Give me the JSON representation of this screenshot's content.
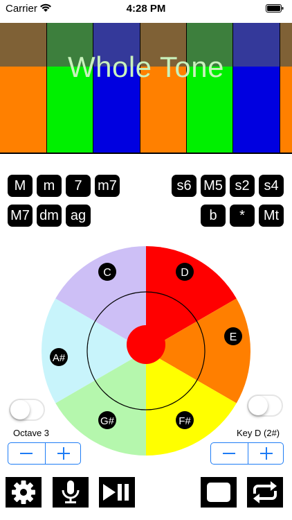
{
  "status_bar": {
    "carrier": "Carrier",
    "time": "4:28 PM"
  },
  "roll": {
    "title": "Whole Tone",
    "colors": [
      "#ff8000",
      "#00f000",
      "#0000e0",
      "#ff8000",
      "#00f000",
      "#0000e0",
      "#ff8000"
    ]
  },
  "chords": {
    "left_row1": [
      "M",
      "m",
      "7",
      "m7"
    ],
    "left_row2": [
      "M7",
      "dm",
      "ag"
    ],
    "right_row1": [
      "s6",
      "M5",
      "s2",
      "s4"
    ],
    "right_row2": [
      "b",
      "*",
      "Mt"
    ]
  },
  "wheel": {
    "notes": {
      "C": "C",
      "D": "D",
      "E": "E",
      "F#": "F#",
      "G#": "G#",
      "A#": "A#"
    },
    "segment_colors": {
      "C": "#cdbff6",
      "D": "#ff0000",
      "E": "#ff7f00",
      "F#": "#ffff00",
      "G#": "#b5f7ad",
      "A#": "#c8f4fb"
    }
  },
  "octave": {
    "label": "Octave 3"
  },
  "key": {
    "label": "Key D (2#)"
  }
}
